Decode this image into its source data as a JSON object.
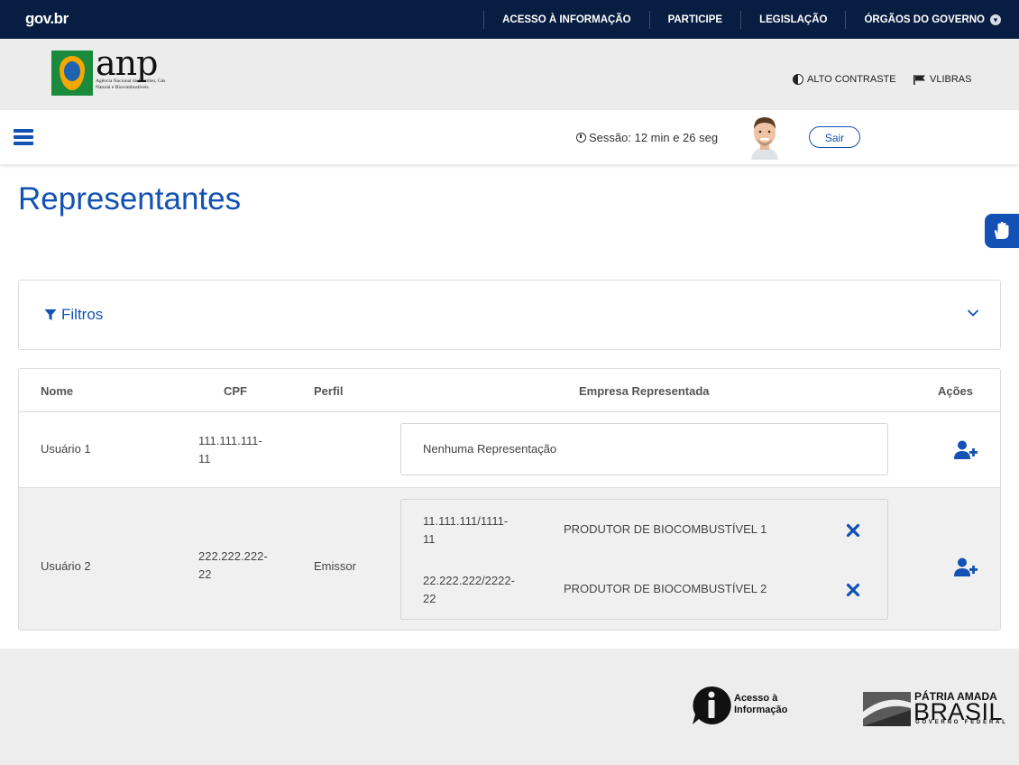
{
  "govbar": {
    "logo": "gov.br",
    "nav": [
      "ACESSO À INFORMAÇÃO",
      "PARTICIPE",
      "LEGISLAÇÃO",
      "ÓRGÃOS DO GOVERNO"
    ]
  },
  "header": {
    "logo_name": "anp",
    "logo_subtitle": "Agência Nacional do Petróleo, Gás Natural e Biocombustíveis",
    "alto_contraste": "ALTO CONTRASTE",
    "vlibras": "VLIBRAS"
  },
  "appbar": {
    "session": "Sessão: 12 min e 26 seg",
    "logout": "Sair"
  },
  "page": {
    "title": "Representantes"
  },
  "filters": {
    "label": "Filtros"
  },
  "table": {
    "headers": {
      "nome": "Nome",
      "cpf": "CPF",
      "perfil": "Perfil",
      "empresa": "Empresa Representada",
      "acoes": "Ações"
    },
    "rows": [
      {
        "nome": "Usuário 1",
        "cpf_line1": "111.111.111-",
        "cpf_line2": "11",
        "perfil": "",
        "empresa_vazia": "Nenhuma Representação"
      },
      {
        "nome": "Usuário 2",
        "cpf_line1": "222.222.222-",
        "cpf_line2": "22",
        "perfil": "Emissor",
        "empresas": [
          {
            "cnpj_line1": "11.111.111/1111-",
            "cnpj_line2": "11",
            "nome": "PRODUTOR DE BIOCOMBUSTÍVEL 1"
          },
          {
            "cnpj_line1": "22.222.222/2222-",
            "cnpj_line2": "22",
            "nome": "PRODUTOR DE BIOCOMBUSTÍVEL 2"
          }
        ]
      }
    ]
  },
  "footer": {
    "acesso_line1": "Acesso à",
    "acesso_line2": "Informação",
    "patria_line1": "PÁTRIA AMADA",
    "patria_line2": "BRASIL",
    "patria_line3": "GOVERNO FEDERAL"
  },
  "colors": {
    "govbar": "#071d41",
    "primary": "#1351b4",
    "header_bg": "#ececec",
    "row_alt": "#f0f0f0"
  },
  "icons": [
    "hamburger-icon",
    "clock-icon",
    "filter-icon",
    "chevron-down-icon",
    "add-user-icon",
    "close-icon",
    "contrast-icon",
    "flag-icon",
    "hand-icon",
    "info-icon"
  ]
}
